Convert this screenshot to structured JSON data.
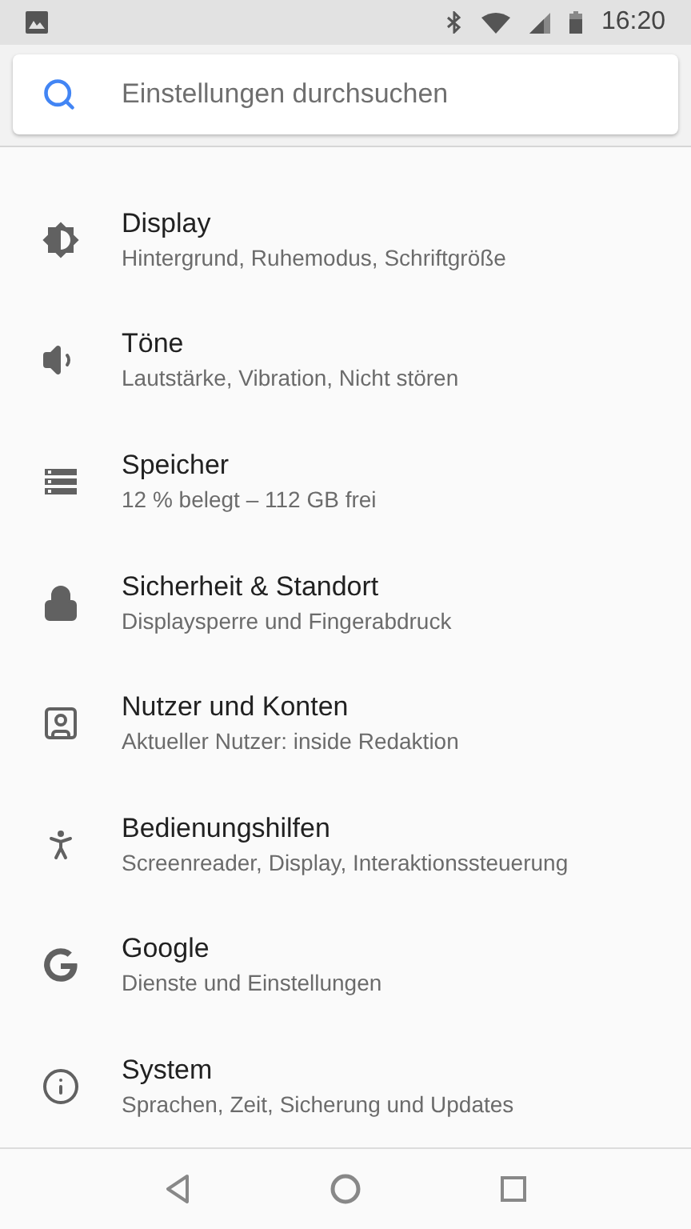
{
  "status_bar": {
    "time": "16:20"
  },
  "search": {
    "placeholder": "Einstellungen durchsuchen"
  },
  "items": [
    {
      "kind": "display",
      "title": "Display",
      "subtitle": "Hintergrund, Ruhemodus, Schriftgröße"
    },
    {
      "kind": "sound",
      "title": "Töne",
      "subtitle": "Lautstärke, Vibration, Nicht stören"
    },
    {
      "kind": "storage",
      "title": "Speicher",
      "subtitle": "12 % belegt – 112 GB frei"
    },
    {
      "kind": "security",
      "title": "Sicherheit & Standort",
      "subtitle": "Displaysperre und Fingerabdruck"
    },
    {
      "kind": "accounts",
      "title": "Nutzer und Konten",
      "subtitle": "Aktueller Nutzer: inside Redaktion"
    },
    {
      "kind": "accessibility",
      "title": "Bedienungshilfen",
      "subtitle": "Screenreader, Display, Interaktionssteuerung"
    },
    {
      "kind": "google",
      "title": "Google",
      "subtitle": "Dienste und Einstellungen"
    },
    {
      "kind": "system",
      "title": "System",
      "subtitle": "Sprachen, Zeit, Sicherung und Updates"
    }
  ]
}
